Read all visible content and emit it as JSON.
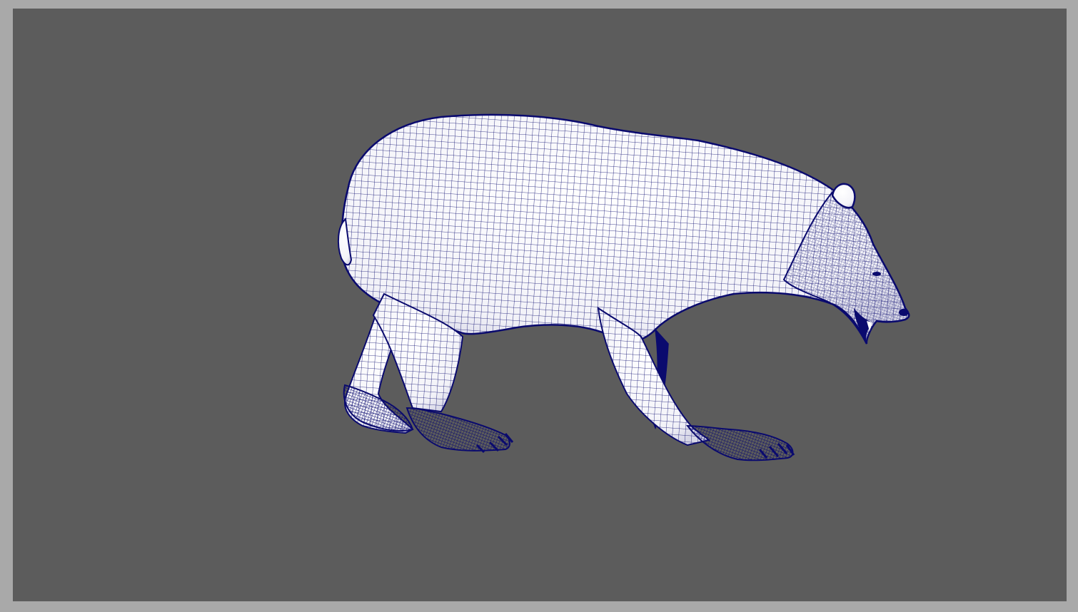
{
  "viewport": {
    "background_color": "#5c5c5c",
    "frame_color": "#a9a9a9",
    "display_mode": "wireframe-on-shaded"
  },
  "model": {
    "subject": "bear",
    "pose": "walking",
    "facing": "right",
    "surface_color": "#ffffff",
    "wire_color": "#0a0a6e"
  }
}
